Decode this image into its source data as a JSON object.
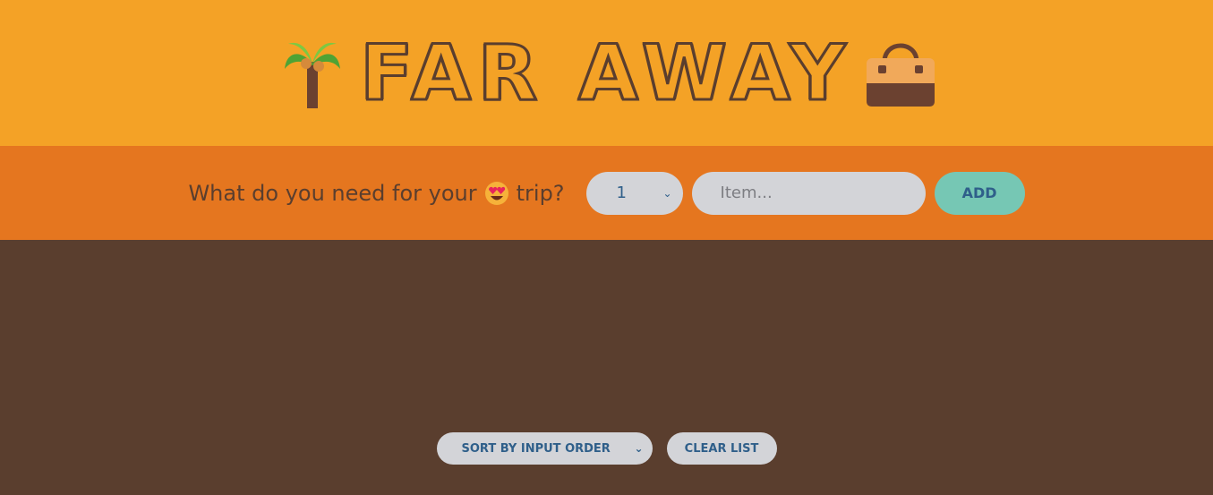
{
  "header": {
    "title": "FAR AWAY",
    "left_icon": "palm-tree-icon",
    "right_icon": "handbag-icon"
  },
  "form": {
    "question_prefix": "What do you need for your",
    "question_suffix": "trip?",
    "emoji_icon": "heart-eyes-icon",
    "quantity_selected": "1",
    "item_placeholder": "Item...",
    "add_label": "ADD"
  },
  "footer": {
    "sort_selected": "SORT BY INPUT ORDER",
    "clear_label": "CLEAR LIST"
  },
  "colors": {
    "header_bg": "#f4a226",
    "form_bg": "#e5761f",
    "list_bg": "#5a3e2e",
    "accent": "#76c7b4"
  }
}
